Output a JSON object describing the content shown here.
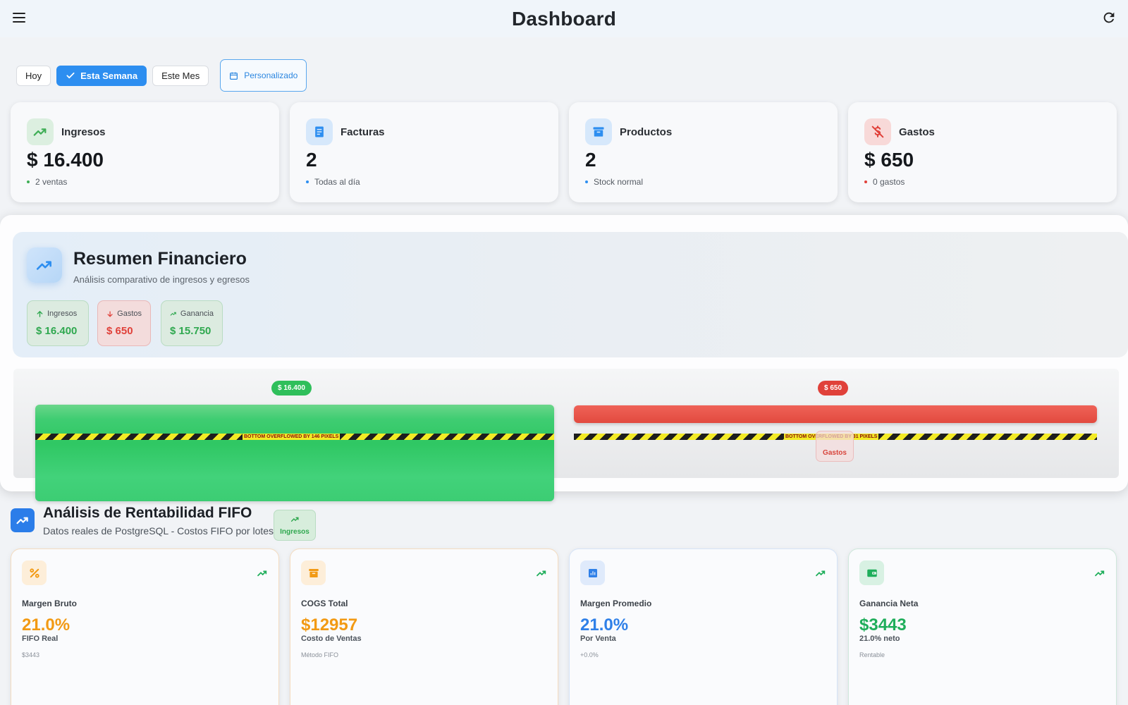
{
  "app": {
    "title": "Dashboard"
  },
  "filters": {
    "today": "Hoy",
    "this_week": "Esta Semana",
    "this_month": "Este Mes",
    "custom": "Personalizado",
    "selected": "Esta Semana"
  },
  "stats": [
    {
      "label": "Ingresos",
      "value": "$ 16.400",
      "sub": "2 ventas",
      "icon": "trending-up-icon",
      "color": "#3fae56"
    },
    {
      "label": "Facturas",
      "value": "2",
      "sub": "Todas al día",
      "icon": "receipt-icon",
      "color": "#2d8ef0"
    },
    {
      "label": "Productos",
      "value": "2",
      "sub": "Stock normal",
      "icon": "archive-icon",
      "color": "#2d8ef0"
    },
    {
      "label": "Gastos",
      "value": "$ 650",
      "sub": "0 gastos",
      "icon": "money-off-icon",
      "color": "#e0413a"
    }
  ],
  "financial": {
    "title": "Resumen Financiero",
    "subtitle": "Análisis comparativo de ingresos y egresos",
    "income": {
      "label": "Ingresos",
      "value": "$ 16.400"
    },
    "expenses": {
      "label": "Gastos",
      "value": "$ 650"
    },
    "profit": {
      "label": "Ganancia",
      "value": "$ 15.750"
    },
    "chart": {
      "income_pill": "$ 16.400",
      "expense_pill": "$ 650",
      "income_overflow": "BOTTOM OVERFLOWED BY 146 PIXELS",
      "expense_overflow": "BOTTOM OVERFLOWED BY 31 PIXELS",
      "income_bar_label": "Ingresos",
      "expense_bar_label": "Gastos",
      "income_color": "#2fc763",
      "expense_color": "#e24a3f"
    }
  },
  "fifo": {
    "title": "Análisis de Rentabilidad FIFO",
    "subtitle": "Datos reales de PostgreSQL - Costos FIFO por lotes",
    "cards": [
      {
        "label": "Margen Bruto",
        "value": "21.0%",
        "sub": "FIFO Real",
        "sub2": "$3443",
        "icon": "percent-icon",
        "color": "#f29a14"
      },
      {
        "label": "COGS Total",
        "value": "$12957",
        "sub": "Costo de Ventas",
        "sub2": "Método FIFO",
        "icon": "archive-icon",
        "color": "#f29a14"
      },
      {
        "label": "Margen Promedio",
        "value": "21.0%",
        "sub": "Por Venta",
        "sub2": "+0.0%",
        "icon": "analytics-icon",
        "color": "#2f80e8"
      },
      {
        "label": "Ganancia Neta",
        "value": "$3443",
        "sub": "21.0% neto",
        "sub2": "Rentable",
        "icon": "wallet-icon",
        "color": "#1fae5b"
      }
    ]
  }
}
